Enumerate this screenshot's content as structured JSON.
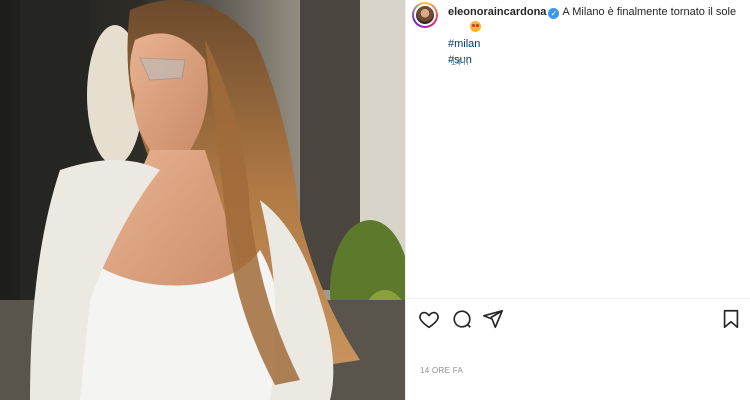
{
  "post": {
    "username": "eleonoraincardona",
    "verified_icon": "verified-badge-icon",
    "caption_text": "A Milano è finalmente tornato il sole",
    "emoji_icon": "star-struck-emoji",
    "hashtags": [
      "#milan",
      "#sun"
    ],
    "time_ago": "14 h",
    "timestamp": "14 ORE FA"
  },
  "actions": {
    "like_icon": "heart-icon",
    "comment_icon": "comment-icon",
    "share_icon": "paper-plane-icon",
    "save_icon": "bookmark-icon"
  },
  "colors": {
    "link": "#00376b",
    "muted": "#8e8e8e",
    "verified": "#3897f0"
  }
}
